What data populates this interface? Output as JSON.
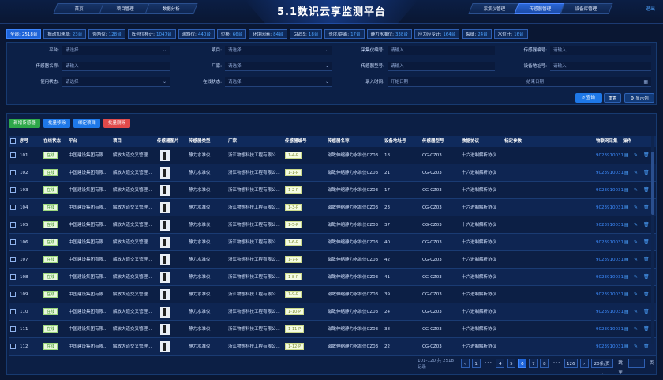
{
  "header": {
    "title": "5.1数识云享监测平台",
    "nav_left": [
      "首页",
      "项目管理",
      "数据分析"
    ],
    "nav_right": [
      "采集仪管理",
      "传感器管理",
      "设备库管理"
    ],
    "active_nav": "传感器管理",
    "logout": "退出"
  },
  "stats": [
    {
      "label": "全部",
      "value": "2518台"
    },
    {
      "label": "振动加速度",
      "value": "23台"
    },
    {
      "label": "倾角仪",
      "value": "128台"
    },
    {
      "label": "阵列位移计",
      "value": "1047台"
    },
    {
      "label": "测斜仪",
      "value": "440台"
    },
    {
      "label": "位移",
      "value": "66台"
    },
    {
      "label": "环境因素",
      "value": "84台"
    },
    {
      "label": "GNSS",
      "value": "18台"
    },
    {
      "label": "长度/距离",
      "value": "17台"
    },
    {
      "label": "静力水准仪",
      "value": "338台"
    },
    {
      "label": "应力应变计",
      "value": "164台"
    },
    {
      "label": "裂缝",
      "value": "24台"
    },
    {
      "label": "水位计",
      "value": "16台"
    }
  ],
  "filters": {
    "platform": {
      "label": "平台:",
      "placeholder": "请选择"
    },
    "project": {
      "label": "项目:",
      "placeholder": "请选择"
    },
    "collector_no": {
      "label": "采集仪编号:",
      "placeholder": "请输入"
    },
    "sensor_no": {
      "label": "传感器编号:",
      "placeholder": "请输入"
    },
    "sensor_name": {
      "label": "传感器名称:",
      "placeholder": "请输入"
    },
    "vendor": {
      "label": "厂家:",
      "placeholder": "请选择"
    },
    "sensor_model": {
      "label": "传感器型号:",
      "placeholder": "请输入"
    },
    "device_addr": {
      "label": "设备地址号:",
      "placeholder": "请输入"
    },
    "use_status": {
      "label": "使用状态:",
      "placeholder": "请选择"
    },
    "online_status": {
      "label": "在线状态:",
      "placeholder": "请选择"
    },
    "entry_time": {
      "label": "录入时间:",
      "start": "开始日期",
      "end": "结束日期"
    }
  },
  "filter_buttons": {
    "search": "查询",
    "reset": "重置",
    "show_cols": "显示列"
  },
  "actions": {
    "add": "新增传感器",
    "batch_move": "批量移除",
    "bind_project": "绑定项目",
    "batch_delete": "批量删除"
  },
  "columns": [
    "序号",
    "在线状态",
    "平台",
    "项目",
    "传感器图片",
    "传感器类型",
    "厂家",
    "传感器编号",
    "传感器名称",
    "设备地址号",
    "传感器型号",
    "数据协议",
    "标定参数",
    "物联网采集",
    "操作"
  ],
  "rows": [
    {
      "no": "101",
      "status": "在线",
      "platform": "中国建设集团有限...",
      "project": "解放大道交叉管理...",
      "type": "静力水准仪",
      "vendor": "浙江物想科技工程有限公...",
      "sensor_no": "1-4-P",
      "name": "磁致伸缩静力水准仪CZ03",
      "addr": "18",
      "model": "CG-CZ03",
      "protocol": "十六进制解析协议",
      "iot": "9023910031"
    },
    {
      "no": "102",
      "status": "在线",
      "platform": "中国建设集团有限...",
      "project": "解放大道交叉管理...",
      "type": "静力水准仪",
      "vendor": "浙江物想科技工程有限公...",
      "sensor_no": "1-1-P",
      "name": "磁致伸缩静力水准仪CZ03",
      "addr": "21",
      "model": "CG-CZ03",
      "protocol": "十六进制解析协议",
      "iot": "9023910031"
    },
    {
      "no": "103",
      "status": "在线",
      "platform": "中国建设集团有限...",
      "project": "解放大道交叉管理...",
      "type": "静力水准仪",
      "vendor": "浙江物想科技工程有限公...",
      "sensor_no": "1-2-P",
      "name": "磁致伸缩静力水准仪CZ03",
      "addr": "17",
      "model": "CG-CZ03",
      "protocol": "十六进制解析协议",
      "iot": "9023910031"
    },
    {
      "no": "104",
      "status": "在线",
      "platform": "中国建设集团有限...",
      "project": "解放大道交叉管理...",
      "type": "静力水准仪",
      "vendor": "浙江物想科技工程有限公...",
      "sensor_no": "1-3-P",
      "name": "磁致伸缩静力水准仪CZ03",
      "addr": "23",
      "model": "CG-CZ03",
      "protocol": "十六进制解析协议",
      "iot": "9023910031"
    },
    {
      "no": "105",
      "status": "在线",
      "platform": "中国建设集团有限...",
      "project": "解放大道交叉管理...",
      "type": "静力水准仪",
      "vendor": "浙江物想科技工程有限公...",
      "sensor_no": "1-5-P",
      "name": "磁致伸缩静力水准仪CZ03",
      "addr": "37",
      "model": "CG-CZ03",
      "protocol": "十六进制解析协议",
      "iot": "9023910031"
    },
    {
      "no": "106",
      "status": "在线",
      "platform": "中国建设集团有限...",
      "project": "解放大道交叉管理...",
      "type": "静力水准仪",
      "vendor": "浙江物想科技工程有限公...",
      "sensor_no": "1-6-P",
      "name": "磁致伸缩静力水准仪CZ03",
      "addr": "40",
      "model": "CG-CZ03",
      "protocol": "十六进制解析协议",
      "iot": "9023910031"
    },
    {
      "no": "107",
      "status": "在线",
      "platform": "中国建设集团有限...",
      "project": "解放大道交叉管理...",
      "type": "静力水准仪",
      "vendor": "浙江物想科技工程有限公...",
      "sensor_no": "1-7-P",
      "name": "磁致伸缩静力水准仪CZ03",
      "addr": "42",
      "model": "CG-CZ03",
      "protocol": "十六进制解析协议",
      "iot": "9023910031"
    },
    {
      "no": "108",
      "status": "在线",
      "platform": "中国建设集团有限...",
      "project": "解放大道交叉管理...",
      "type": "静力水准仪",
      "vendor": "浙江物想科技工程有限公...",
      "sensor_no": "1-8-P",
      "name": "磁致伸缩静力水准仪CZ03",
      "addr": "41",
      "model": "CG-CZ03",
      "protocol": "十六进制解析协议",
      "iot": "9023910031"
    },
    {
      "no": "109",
      "status": "在线",
      "platform": "中国建设集团有限...",
      "project": "解放大道交叉管理...",
      "type": "静力水准仪",
      "vendor": "浙江物想科技工程有限公...",
      "sensor_no": "1-9-P",
      "name": "磁致伸缩静力水准仪CZ03",
      "addr": "39",
      "model": "CG-CZ03",
      "protocol": "十六进制解析协议",
      "iot": "9023910031"
    },
    {
      "no": "110",
      "status": "在线",
      "platform": "中国建设集团有限...",
      "project": "解放大道交叉管理...",
      "type": "静力水准仪",
      "vendor": "浙江物想科技工程有限公...",
      "sensor_no": "1-10-P",
      "name": "磁致伸缩静力水准仪CZ03",
      "addr": "24",
      "model": "CG-CZ03",
      "protocol": "十六进制解析协议",
      "iot": "9023910031"
    },
    {
      "no": "111",
      "status": "在线",
      "platform": "中国建设集团有限...",
      "project": "解放大道交叉管理...",
      "type": "静力水准仪",
      "vendor": "浙江物想科技工程有限公...",
      "sensor_no": "1-11-P",
      "name": "磁致伸缩静力水准仪CZ03",
      "addr": "38",
      "model": "CG-CZ03",
      "protocol": "十六进制解析协议",
      "iot": "9023910031"
    },
    {
      "no": "112",
      "status": "在线",
      "platform": "中国建设集团有限...",
      "project": "解放大道交叉管理...",
      "type": "静力水准仪",
      "vendor": "浙江物想科技工程有限公...",
      "sensor_no": "1-12-P",
      "name": "磁致伸缩静力水准仪CZ03",
      "addr": "22",
      "model": "CG-CZ03",
      "protocol": "十六进制解析协议",
      "iot": "9023910031"
    }
  ],
  "pagination": {
    "summary": "101-120 共 2518 记录",
    "pages": [
      "1",
      "•••",
      "4",
      "5",
      "6",
      "7",
      "8",
      "•••",
      "126"
    ],
    "current": "6",
    "page_size": "20条/页",
    "jump_label": "跳至",
    "page_suffix": "页"
  }
}
